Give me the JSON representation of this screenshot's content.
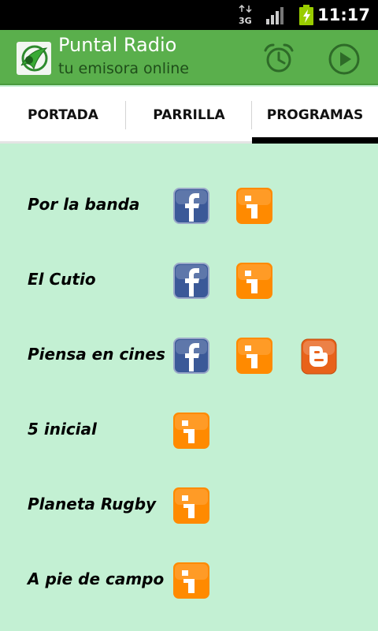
{
  "status_bar": {
    "time": "11:17",
    "network": "3G",
    "icons": [
      "3g-icon",
      "signal-icon",
      "battery-charging-icon"
    ]
  },
  "action_bar": {
    "title": "Puntal Radio",
    "subtitle": "tu emisora online",
    "icons": [
      "app-logo-icon",
      "alarm-icon",
      "play-icon"
    ],
    "color": "#5aaf4c"
  },
  "tabs": [
    {
      "label": "PORTADA",
      "selected": false
    },
    {
      "label": "PARRILLA",
      "selected": false
    },
    {
      "label": "PROGRAMAS",
      "selected": true
    }
  ],
  "programs": [
    {
      "name": "Por la banda",
      "links": [
        "facebook-icon",
        "info-icon"
      ]
    },
    {
      "name": "El Cutio",
      "links": [
        "facebook-icon",
        "info-icon"
      ]
    },
    {
      "name": "Piensa en cines",
      "links": [
        "facebook-icon",
        "info-icon",
        "blogger-icon"
      ]
    },
    {
      "name": "5 inicial",
      "links": [
        "info-icon"
      ]
    },
    {
      "name": "Planeta Rugby",
      "links": [
        "info-icon"
      ]
    },
    {
      "name": "A pie de campo",
      "links": [
        "info-icon"
      ]
    }
  ],
  "colors": {
    "background": "#c3f0d3",
    "facebook": "#3b5998",
    "info": "#ff8a00",
    "blogger": "#e8621a"
  }
}
